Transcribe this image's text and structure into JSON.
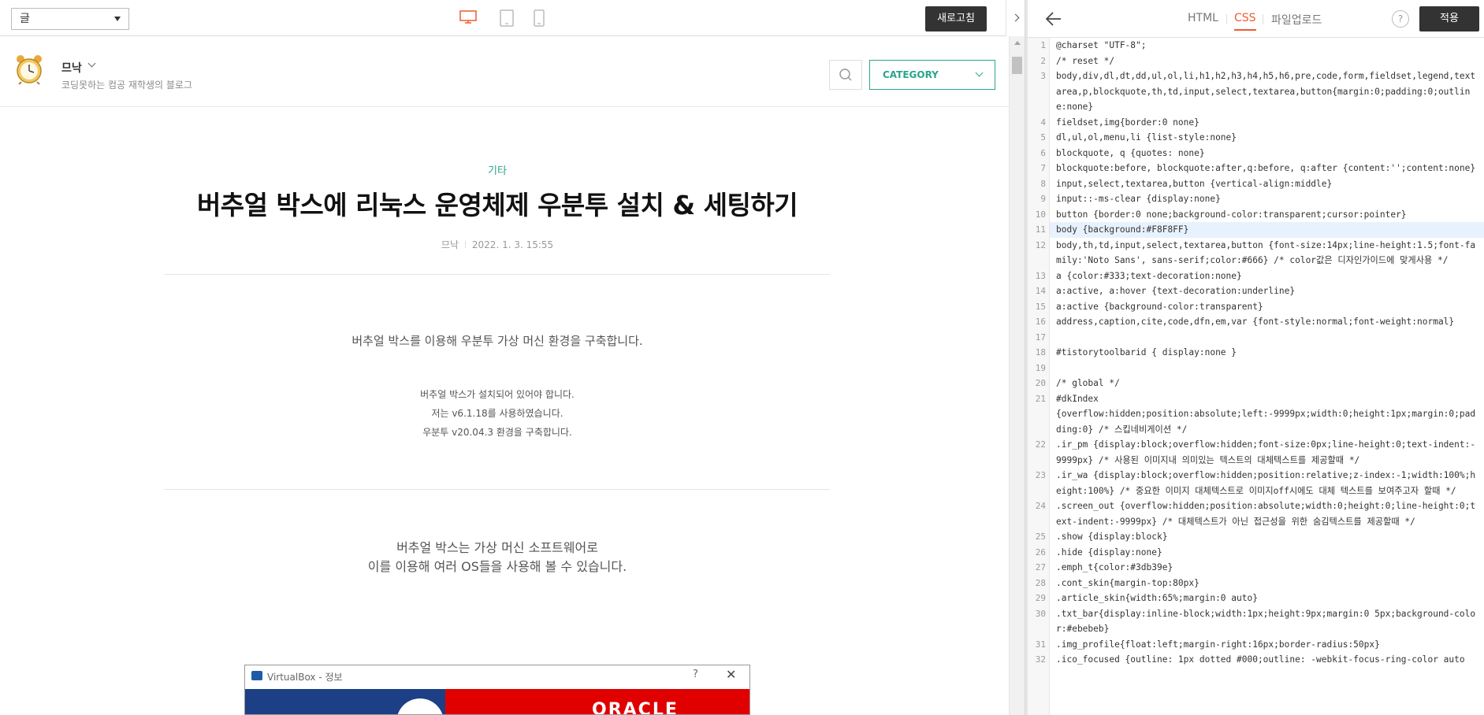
{
  "toolbar": {
    "view_select": "글",
    "refresh_label": "새로고침"
  },
  "blog": {
    "name": "므낙",
    "description": "코딩못하는 컴공 재학생의 블로그",
    "category_label": "CATEGORY"
  },
  "article": {
    "category": "기타",
    "title": "버추얼 박스에 리눅스 운영체제 우분투 설치 & 세팅하기",
    "author": "므낙",
    "date": "2022. 1. 3. 15:55",
    "intro": "버추얼 박스를 이용해 우분투 가상 머신 환경을 구축합니다.",
    "notes": [
      "버추얼 박스가 설치되어 있어야 합니다.",
      "저는 v6.1.18를 사용하였습니다.",
      "우분투 v20.04.3 환경을 구축합니다."
    ],
    "vbox_line1": "버추얼 박스는 가상 머신 소프트웨어로",
    "vbox_line2": "이를 이용해 여러 OS들을 사용해 볼 수 있습니다.",
    "screenshot_title": "VirtualBox - 정보",
    "screenshot_help": "?",
    "screenshot_close": "✕",
    "screenshot_word": "ORACLE"
  },
  "editor": {
    "tabs": [
      "HTML",
      "CSS",
      "파일업로드"
    ],
    "active_tab": "CSS",
    "help_label": "?",
    "apply_label": "적용",
    "highlighted_line": 11,
    "lines": [
      {
        "n": "1",
        "text": "@charset \"UTF-8\";"
      },
      {
        "n": "2",
        "text": "/* reset */"
      },
      {
        "n": "3",
        "text": "body,div,dl,dt,dd,ul,ol,li,h1,h2,h3,h4,h5,h6,pre,code,form,fieldset,legend,textarea,p,blockquote,th,td,input,select,textarea,button{margin:0;padding:0;outline:none}"
      },
      {
        "n": "4",
        "text": "fieldset,img{border:0 none}"
      },
      {
        "n": "5",
        "text": "dl,ul,ol,menu,li {list-style:none}"
      },
      {
        "n": "6",
        "text": "blockquote, q {quotes: none}"
      },
      {
        "n": "7",
        "text": "blockquote:before, blockquote:after,q:before, q:after {content:'';content:none}"
      },
      {
        "n": "8",
        "text": "input,select,textarea,button {vertical-align:middle}"
      },
      {
        "n": "9",
        "text": "input::-ms-clear {display:none}"
      },
      {
        "n": "10",
        "text": "button {border:0 none;background-color:transparent;cursor:pointer}"
      },
      {
        "n": "11",
        "text": "body {background:#F8F8FF}"
      },
      {
        "n": "12",
        "text": "body,th,td,input,select,textarea,button {font-size:14px;line-height:1.5;font-family:'Noto Sans', sans-serif;color:#666} /* color값은 디자인가이드에 맞게사용 */"
      },
      {
        "n": "13",
        "text": "a {color:#333;text-decoration:none}"
      },
      {
        "n": "14",
        "text": "a:active, a:hover {text-decoration:underline}"
      },
      {
        "n": "15",
        "text": "a:active {background-color:transparent}"
      },
      {
        "n": "16",
        "text": "address,caption,cite,code,dfn,em,var {font-style:normal;font-weight:normal}"
      },
      {
        "n": "17",
        "text": ""
      },
      {
        "n": "18",
        "text": "#tistorytoolbarid { display:none }"
      },
      {
        "n": "19",
        "text": ""
      },
      {
        "n": "20",
        "text": "/* global */"
      },
      {
        "n": "21",
        "text": "#dkIndex"
      },
      {
        "n": "",
        "text": "{overflow:hidden;position:absolute;left:-9999px;width:0;height:1px;margin:0;padding:0} /* 스킵네비게이션 */"
      },
      {
        "n": "22",
        "text": ".ir_pm {display:block;overflow:hidden;font-size:0px;line-height:0;text-indent:-9999px} /* 사용된 이미지내 의미있는 텍스트의 대체텍스트를 제공할때 */"
      },
      {
        "n": "23",
        "text": ".ir_wa {display:block;overflow:hidden;position:relative;z-index:-1;width:100%;height:100%} /* 중요한 이미지 대체텍스트로 이미지off시에도 대체 텍스트를 보여주고자 할때 */"
      },
      {
        "n": "24",
        "text": ".screen_out {overflow:hidden;position:absolute;width:0;height:0;line-height:0;text-indent:-9999px} /* 대체텍스트가 아닌 접근성을 위한 숨김텍스트를 제공할때 */"
      },
      {
        "n": "25",
        "text": ".show {display:block}"
      },
      {
        "n": "26",
        "text": ".hide {display:none}"
      },
      {
        "n": "27",
        "text": ".emph_t{color:#3db39e}"
      },
      {
        "n": "28",
        "text": ".cont_skin{margin-top:80px}"
      },
      {
        "n": "29",
        "text": ".article_skin{width:65%;margin:0 auto}"
      },
      {
        "n": "30",
        "text": ".txt_bar{display:inline-block;width:1px;height:9px;margin:0 5px;background-color:#ebebeb}"
      },
      {
        "n": "31",
        "text": ".img_profile{float:left;margin-right:16px;border-radius:50px}"
      },
      {
        "n": "32",
        "text": ".ico_focused {outline: 1px dotted #000;outline: -webkit-focus-ring-color auto"
      }
    ]
  }
}
